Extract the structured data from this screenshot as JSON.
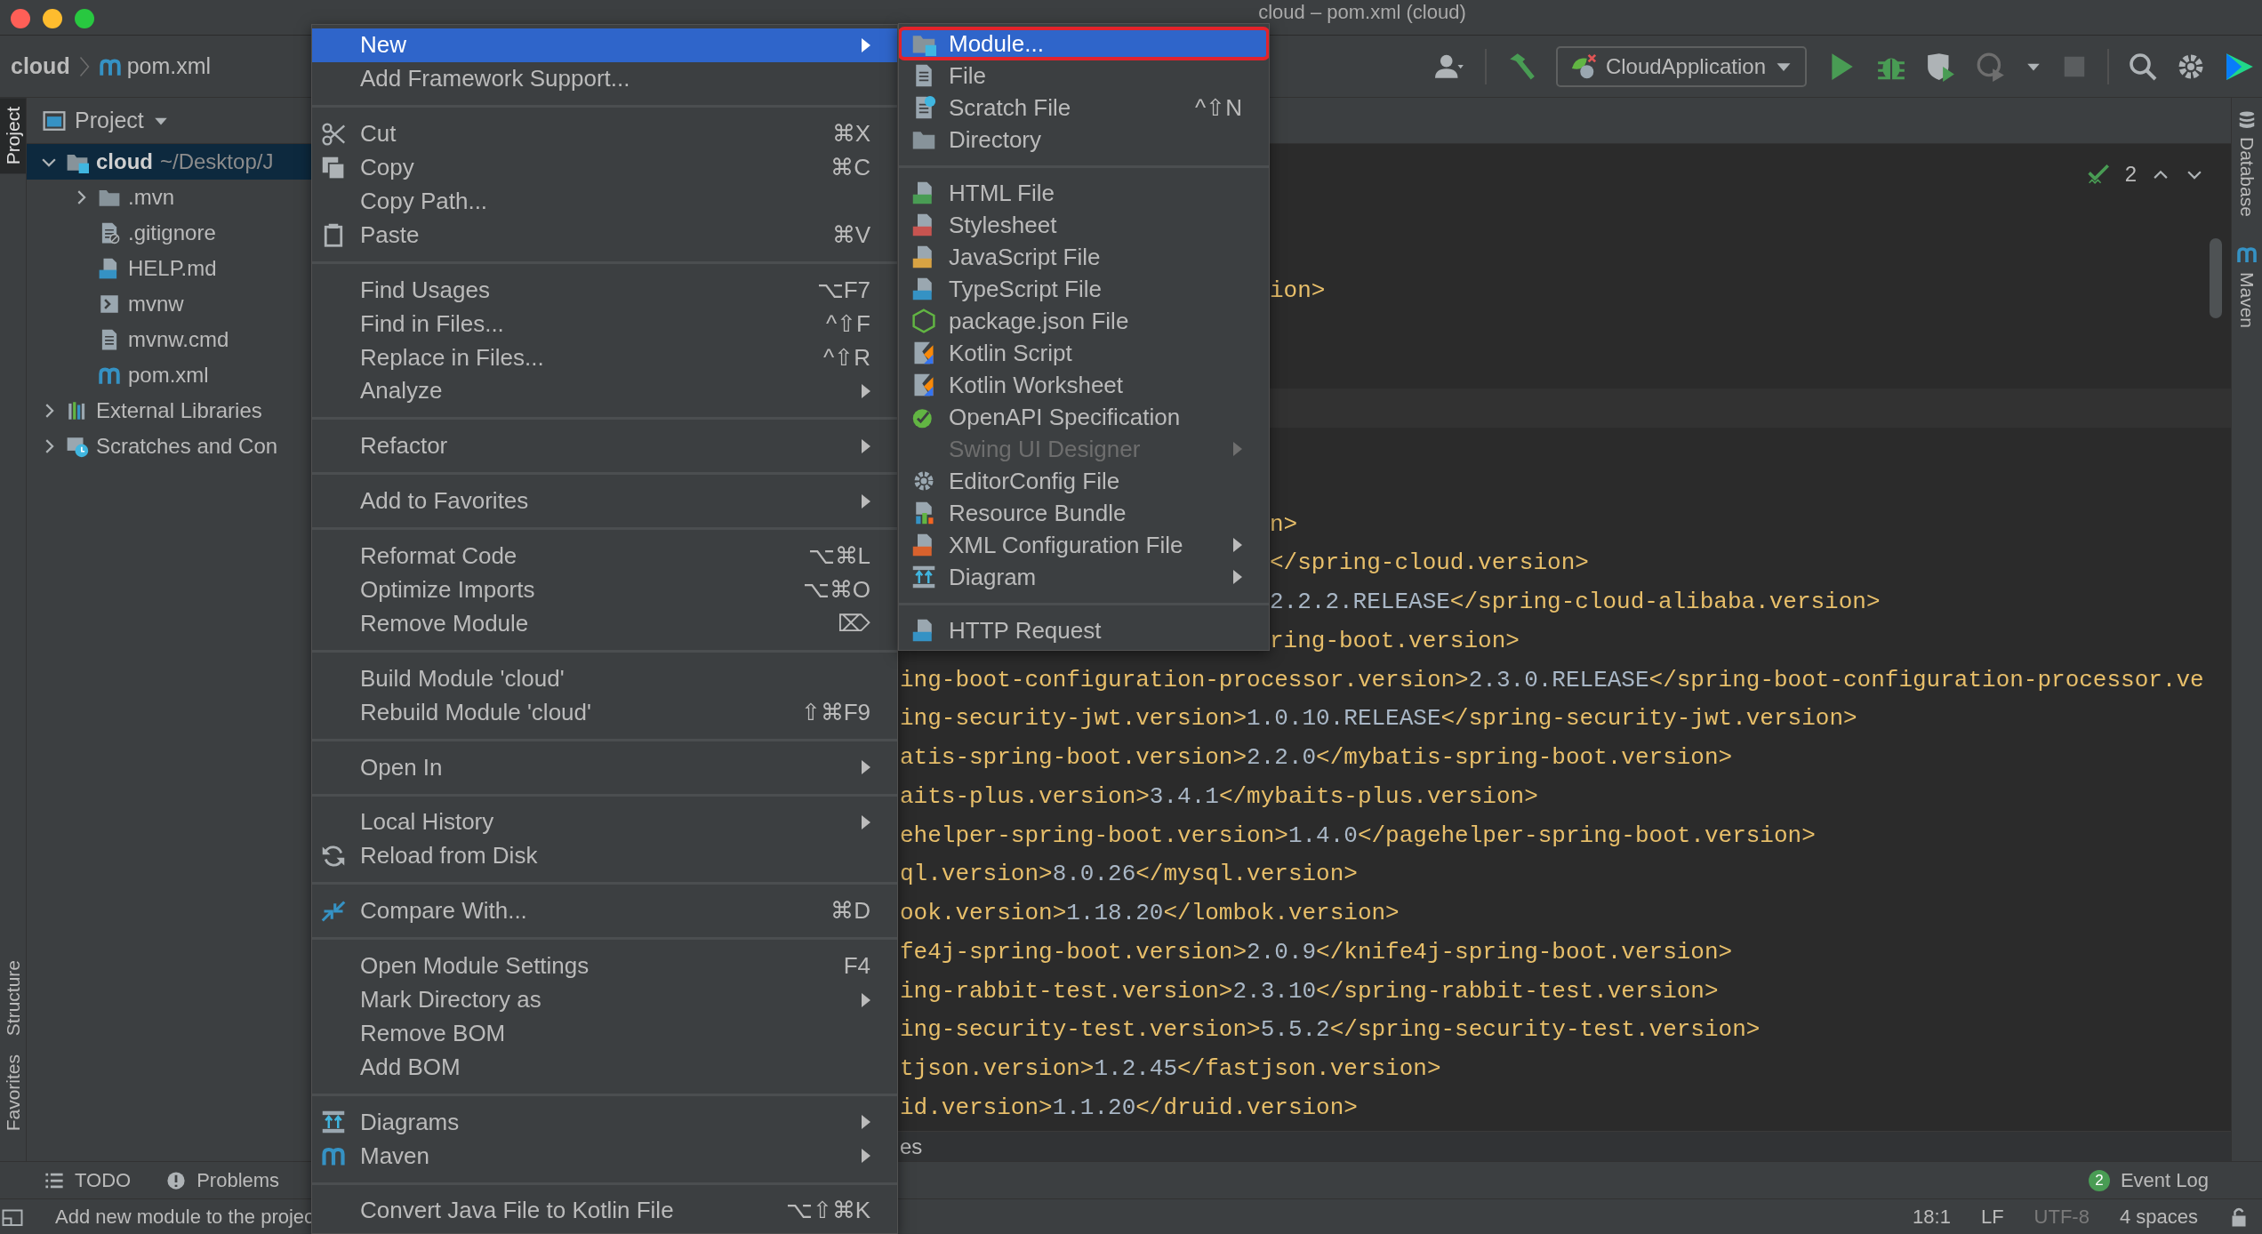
{
  "window": {
    "title": "cloud – pom.xml (cloud)"
  },
  "navigation_bar": {
    "breadcrumbs": [
      {
        "label": "cloud",
        "kind": "project"
      },
      {
        "label": "pom.xml",
        "kind": "maven"
      }
    ],
    "run_configuration": "CloudApplication"
  },
  "left_stripe": [
    {
      "label": "Project",
      "selected": true
    },
    {
      "label": "Structure",
      "selected": false
    },
    {
      "label": "Favorites",
      "selected": false
    }
  ],
  "project_panel": {
    "title": "Project",
    "tree": [
      {
        "label": "cloud",
        "path": "~/Desktop/J",
        "kind": "module",
        "expanded": true,
        "selected": true,
        "children": [
          {
            "label": ".mvn",
            "kind": "folder",
            "expanded": false,
            "selected": false
          },
          {
            "label": ".gitignore",
            "kind": "ignored_file",
            "selected": false
          },
          {
            "label": "HELP.md",
            "kind": "markdown",
            "selected": false
          },
          {
            "label": "mvnw",
            "kind": "script",
            "selected": false
          },
          {
            "label": "mvnw.cmd",
            "kind": "text_file",
            "selected": false
          },
          {
            "label": "pom.xml",
            "kind": "maven",
            "selected": false
          }
        ]
      },
      {
        "label": "External Libraries",
        "kind": "libraries",
        "expanded": false,
        "selected": false
      },
      {
        "label": "Scratches and Con",
        "kind": "scratches",
        "expanded": false,
        "selected": false
      }
    ]
  },
  "editor": {
    "inspection_count": "2",
    "breadcrumb": "es",
    "lines_above": [
      {
        "kind": "past_submenu",
        "segments": [
          {
            "kind": "tag",
            "text": "ion>"
          }
        ]
      }
    ],
    "code_lines": [
      {
        "kind": "past_submenu",
        "segments": [
          {
            "kind": "tag",
            "text": "n>"
          }
        ]
      },
      {
        "kind": "past_submenu",
        "segments": [
          {
            "kind": "tag",
            "text": "</spring-cloud.version>"
          }
        ]
      },
      {
        "kind": "past_submenu",
        "segments": [
          {
            "kind": "value",
            "text": "2.2.2.RELEASE"
          },
          {
            "kind": "tag",
            "text": "</spring-cloud-alibaba.version>"
          }
        ]
      },
      {
        "kind": "past_submenu",
        "segments": [
          {
            "kind": "tag",
            "text": "ring-boot.version>"
          }
        ]
      },
      {
        "kind": "past_menu",
        "segments": [
          {
            "kind": "tag",
            "text": "ing-boot-configuration-processor.version>"
          },
          {
            "kind": "value",
            "text": "2.3.0.RELEASE"
          },
          {
            "kind": "tag",
            "text": "</spring-boot-configuration-processor.ve"
          }
        ]
      },
      {
        "kind": "past_menu",
        "segments": [
          {
            "kind": "tag",
            "text": "ing-security-jwt.version>"
          },
          {
            "kind": "value",
            "text": "1.0.10.RELEASE"
          },
          {
            "kind": "tag",
            "text": "</spring-security-jwt.version>"
          }
        ]
      },
      {
        "kind": "past_menu",
        "segments": [
          {
            "kind": "tag",
            "text": "atis-spring-boot.version>"
          },
          {
            "kind": "value",
            "text": "2.2.0"
          },
          {
            "kind": "tag",
            "text": "</mybatis-spring-boot.version>"
          }
        ]
      },
      {
        "kind": "past_menu",
        "segments": [
          {
            "kind": "tag",
            "text": "aits-plus.version>"
          },
          {
            "kind": "value",
            "text": "3.4.1"
          },
          {
            "kind": "tag",
            "text": "</mybaits-plus.version>"
          }
        ]
      },
      {
        "kind": "past_menu",
        "segments": [
          {
            "kind": "tag",
            "text": "ehelper-spring-boot.version>"
          },
          {
            "kind": "value",
            "text": "1.4.0"
          },
          {
            "kind": "tag",
            "text": "</pagehelper-spring-boot.version>"
          }
        ]
      },
      {
        "kind": "past_menu",
        "segments": [
          {
            "kind": "tag",
            "text": "ql.version>"
          },
          {
            "kind": "value",
            "text": "8.0.26"
          },
          {
            "kind": "tag",
            "text": "</mysql.version>"
          }
        ]
      },
      {
        "kind": "past_menu",
        "segments": [
          {
            "kind": "tag",
            "text": "ook.version>"
          },
          {
            "kind": "value",
            "text": "1.18.20"
          },
          {
            "kind": "tag",
            "text": "</lombok.version>"
          }
        ]
      },
      {
        "kind": "past_menu",
        "segments": [
          {
            "kind": "tag",
            "text": "fe4j-spring-boot.version>"
          },
          {
            "kind": "value",
            "text": "2.0.9"
          },
          {
            "kind": "tag",
            "text": "</knife4j-spring-boot.version>"
          }
        ]
      },
      {
        "kind": "past_menu",
        "segments": [
          {
            "kind": "tag",
            "text": "ing-rabbit-test.version>"
          },
          {
            "kind": "value",
            "text": "2.3.10"
          },
          {
            "kind": "tag",
            "text": "</spring-rabbit-test.version>"
          }
        ]
      },
      {
        "kind": "past_menu",
        "segments": [
          {
            "kind": "tag",
            "text": "ing-security-test.version>"
          },
          {
            "kind": "value",
            "text": "5.5.2"
          },
          {
            "kind": "tag",
            "text": "</spring-security-test.version>"
          }
        ]
      },
      {
        "kind": "past_menu",
        "segments": [
          {
            "kind": "tag",
            "text": "tjson.version>"
          },
          {
            "kind": "value",
            "text": "1.2.45"
          },
          {
            "kind": "tag",
            "text": "</fastjson.version>"
          }
        ]
      },
      {
        "kind": "past_menu",
        "segments": [
          {
            "kind": "tag",
            "text": "id.version>"
          },
          {
            "kind": "value",
            "text": "1.1.20"
          },
          {
            "kind": "tag",
            "text": "</druid.version>"
          }
        ]
      }
    ]
  },
  "right_stripe": [
    {
      "label": "Database"
    },
    {
      "label": "Maven"
    }
  ],
  "context_menu": {
    "groups": [
      [
        {
          "label": "New",
          "submenu": true,
          "selected": true
        },
        {
          "label": "Add Framework Support...",
          "submenu": false,
          "selected": false
        }
      ],
      [
        {
          "label": "Cut",
          "shortcut": "⌘X",
          "submenu": false,
          "selected": false
        },
        {
          "label": "Copy",
          "shortcut": "⌘C",
          "submenu": false,
          "selected": false
        },
        {
          "label": "Copy Path...",
          "submenu": false,
          "selected": false
        },
        {
          "label": "Paste",
          "shortcut": "⌘V",
          "submenu": false,
          "selected": false
        }
      ],
      [
        {
          "label": "Find Usages",
          "shortcut": "⌥F7",
          "submenu": false,
          "selected": false
        },
        {
          "label": "Find in Files...",
          "shortcut": "^⇧F",
          "submenu": false,
          "selected": false
        },
        {
          "label": "Replace in Files...",
          "shortcut": "^⇧R",
          "submenu": false,
          "selected": false
        },
        {
          "label": "Analyze",
          "submenu": true,
          "selected": false
        }
      ],
      [
        {
          "label": "Refactor",
          "submenu": true,
          "selected": false
        }
      ],
      [
        {
          "label": "Add to Favorites",
          "submenu": true,
          "selected": false
        }
      ],
      [
        {
          "label": "Reformat Code",
          "shortcut": "⌥⌘L",
          "submenu": false,
          "selected": false
        },
        {
          "label": "Optimize Imports",
          "shortcut": "⌥⌘O",
          "submenu": false,
          "selected": false
        },
        {
          "label": "Remove Module",
          "shortcut": "⌦",
          "submenu": false,
          "selected": false
        }
      ],
      [
        {
          "label": "Build Module 'cloud'",
          "submenu": false,
          "selected": false
        },
        {
          "label": "Rebuild Module 'cloud'",
          "shortcut": "⇧⌘F9",
          "submenu": false,
          "selected": false
        }
      ],
      [
        {
          "label": "Open In",
          "submenu": true,
          "selected": false
        }
      ],
      [
        {
          "label": "Local History",
          "submenu": true,
          "selected": false
        },
        {
          "label": "Reload from Disk",
          "submenu": false,
          "selected": false
        }
      ],
      [
        {
          "label": "Compare With...",
          "shortcut": "⌘D",
          "submenu": false,
          "selected": false
        }
      ],
      [
        {
          "label": "Open Module Settings",
          "shortcut": "F4",
          "submenu": false,
          "selected": false
        },
        {
          "label": "Mark Directory as",
          "submenu": true,
          "selected": false
        },
        {
          "label": "Remove BOM",
          "submenu": false,
          "selected": false
        },
        {
          "label": "Add BOM",
          "submenu": false,
          "selected": false
        }
      ],
      [
        {
          "label": "Diagrams",
          "submenu": true,
          "selected": false
        },
        {
          "label": "Maven",
          "submenu": true,
          "selected": false
        }
      ],
      [
        {
          "label": "Convert Java File to Kotlin File",
          "shortcut": "⌥⇧⌘K",
          "submenu": false,
          "selected": false
        }
      ]
    ]
  },
  "submenu": {
    "groups": [
      [
        {
          "label": "Module...",
          "submenu": false,
          "selected": true,
          "outlined": true,
          "disabled": false
        },
        {
          "label": "File",
          "submenu": false,
          "selected": false,
          "outlined": false,
          "disabled": false
        },
        {
          "label": "Scratch File",
          "shortcut": "^⇧N",
          "submenu": false,
          "selected": false,
          "outlined": false,
          "disabled": false
        },
        {
          "label": "Directory",
          "submenu": false,
          "selected": false,
          "outlined": false,
          "disabled": false
        }
      ],
      [
        {
          "label": "HTML File",
          "submenu": false,
          "selected": false,
          "outlined": false,
          "disabled": false
        },
        {
          "label": "Stylesheet",
          "submenu": false,
          "selected": false,
          "outlined": false,
          "disabled": false
        },
        {
          "label": "JavaScript File",
          "submenu": false,
          "selected": false,
          "outlined": false,
          "disabled": false
        },
        {
          "label": "TypeScript File",
          "submenu": false,
          "selected": false,
          "outlined": false,
          "disabled": false
        },
        {
          "label": "package.json File",
          "submenu": false,
          "selected": false,
          "outlined": false,
          "disabled": false
        },
        {
          "label": "Kotlin Script",
          "submenu": false,
          "selected": false,
          "outlined": false,
          "disabled": false
        },
        {
          "label": "Kotlin Worksheet",
          "submenu": false,
          "selected": false,
          "outlined": false,
          "disabled": false
        },
        {
          "label": "OpenAPI Specification",
          "submenu": false,
          "selected": false,
          "outlined": false,
          "disabled": false
        },
        {
          "label": "Swing UI Designer",
          "submenu": true,
          "selected": false,
          "outlined": false,
          "disabled": true
        },
        {
          "label": "EditorConfig File",
          "submenu": false,
          "selected": false,
          "outlined": false,
          "disabled": false
        },
        {
          "label": "Resource Bundle",
          "submenu": false,
          "selected": false,
          "outlined": false,
          "disabled": false
        },
        {
          "label": "XML Configuration File",
          "submenu": true,
          "selected": false,
          "outlined": false,
          "disabled": false
        },
        {
          "label": "Diagram",
          "submenu": true,
          "selected": false,
          "outlined": false,
          "disabled": false
        }
      ],
      [
        {
          "label": "HTTP Request",
          "submenu": false,
          "selected": false,
          "outlined": false,
          "disabled": false
        }
      ]
    ]
  },
  "tool_window_bar": {
    "tabs": [
      {
        "label": "TODO"
      },
      {
        "label": "Problems"
      }
    ],
    "event_log": {
      "label": "Event Log",
      "badge": "2"
    }
  },
  "status_bar": {
    "message": "Add new module to the projec",
    "position": "18:1",
    "line_separator": "LF",
    "encoding": "UTF-8",
    "indent": "4 spaces"
  }
}
